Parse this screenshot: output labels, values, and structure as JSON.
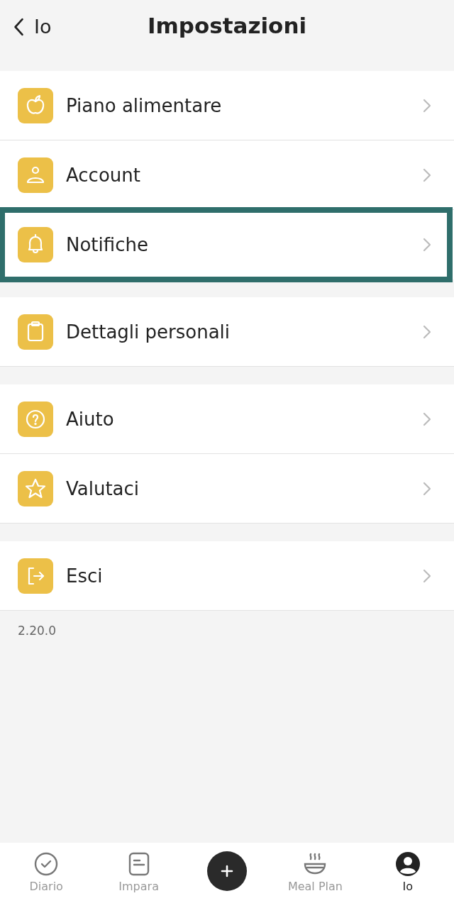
{
  "header": {
    "back_label": "Io",
    "title": "Impostazioni"
  },
  "groups": [
    {
      "items": [
        {
          "label": "Piano alimentare",
          "highlighted": false
        },
        {
          "label": "Account",
          "highlighted": false
        },
        {
          "label": "Notifiche",
          "highlighted": true
        }
      ]
    },
    {
      "items": [
        {
          "label": "Dettagli personali",
          "highlighted": false
        }
      ]
    },
    {
      "items": [
        {
          "label": "Aiuto",
          "highlighted": false
        },
        {
          "label": "Valutaci",
          "highlighted": false
        }
      ]
    },
    {
      "items": [
        {
          "label": "Esci",
          "highlighted": false
        }
      ]
    }
  ],
  "version": "2.20.0",
  "tab_bar": [
    {
      "label": "Diario",
      "selected": false
    },
    {
      "label": "Impara",
      "selected": false
    },
    {
      "kind": "add"
    },
    {
      "label": "Meal Plan",
      "selected": false
    },
    {
      "label": "Io",
      "selected": true
    }
  ]
}
